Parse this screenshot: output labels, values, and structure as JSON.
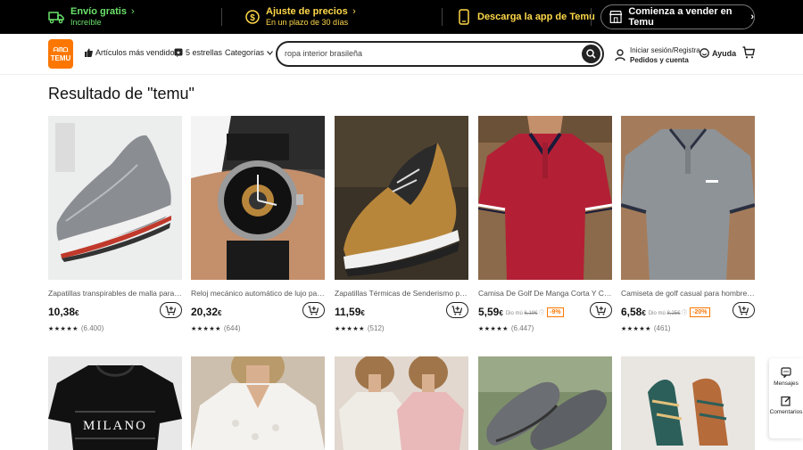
{
  "topbar": {
    "shipping_title": "Envío gratis",
    "shipping_sub": "Increíble",
    "price_title": "Ajuste de precios",
    "price_sub": "En un plazo de 30 días",
    "app_label": "Descarga la app de Temu",
    "sell_label": "Comienza a vender en Temu"
  },
  "header": {
    "logo_line1": "ᗩᗰᗝ",
    "logo_line2": "TEMU",
    "nav_bestsellers": "Artículos más vendidos",
    "nav_stars": "5 estrellas",
    "nav_categories": "Categorías",
    "search_value": "ropa interior brasileña",
    "signin_line1": "Iniciar sesión/Registra",
    "signin_line2": "Pedidos y cuenta",
    "help_label": "Ayuda"
  },
  "result_title": "Resultado de \"temu\"",
  "products": [
    {
      "name": "Zapatillas transpirables de malla para hom...",
      "price_int": "10,38",
      "price_cur": "€",
      "rating": "★★★★★",
      "count": "(6.400)"
    },
    {
      "name": "Reloj mecánico automático de lujo para ho...",
      "price_int": "20,32",
      "price_cur": "€",
      "rating": "★★★★★",
      "count": "(644)"
    },
    {
      "name": "Zapatillas Térmicas de Senderismo para Ho...",
      "price_int": "11,59",
      "price_cur": "€",
      "rating": "★★★★★",
      "count": "(512)"
    },
    {
      "name": "Camisa De Golf De Manga Corta Y Cuello ...",
      "price_int": "5,59",
      "price_cur": "€",
      "orig_label": "Dio mú",
      "orig_price": "6,19€",
      "discount": "-9%",
      "rating": "★★★★★",
      "count": "(6.447)"
    },
    {
      "name": "Camiseta de golf casual para hombre Barb...",
      "price_int": "6,58",
      "price_cur": "€",
      "orig_label": "Dio mú",
      "orig_price": "8,25€",
      "discount": "-20%",
      "rating": "★★★★★",
      "count": "(461)"
    }
  ],
  "row2": {
    "shirt_text": "MILANO"
  },
  "side": {
    "messages": "Mensajes",
    "comments": "Comentarios"
  },
  "colors": {
    "accent": "#fb7701",
    "topbar_bg": "#000000",
    "green": "#6be36b",
    "yellow": "#ffd84a"
  }
}
